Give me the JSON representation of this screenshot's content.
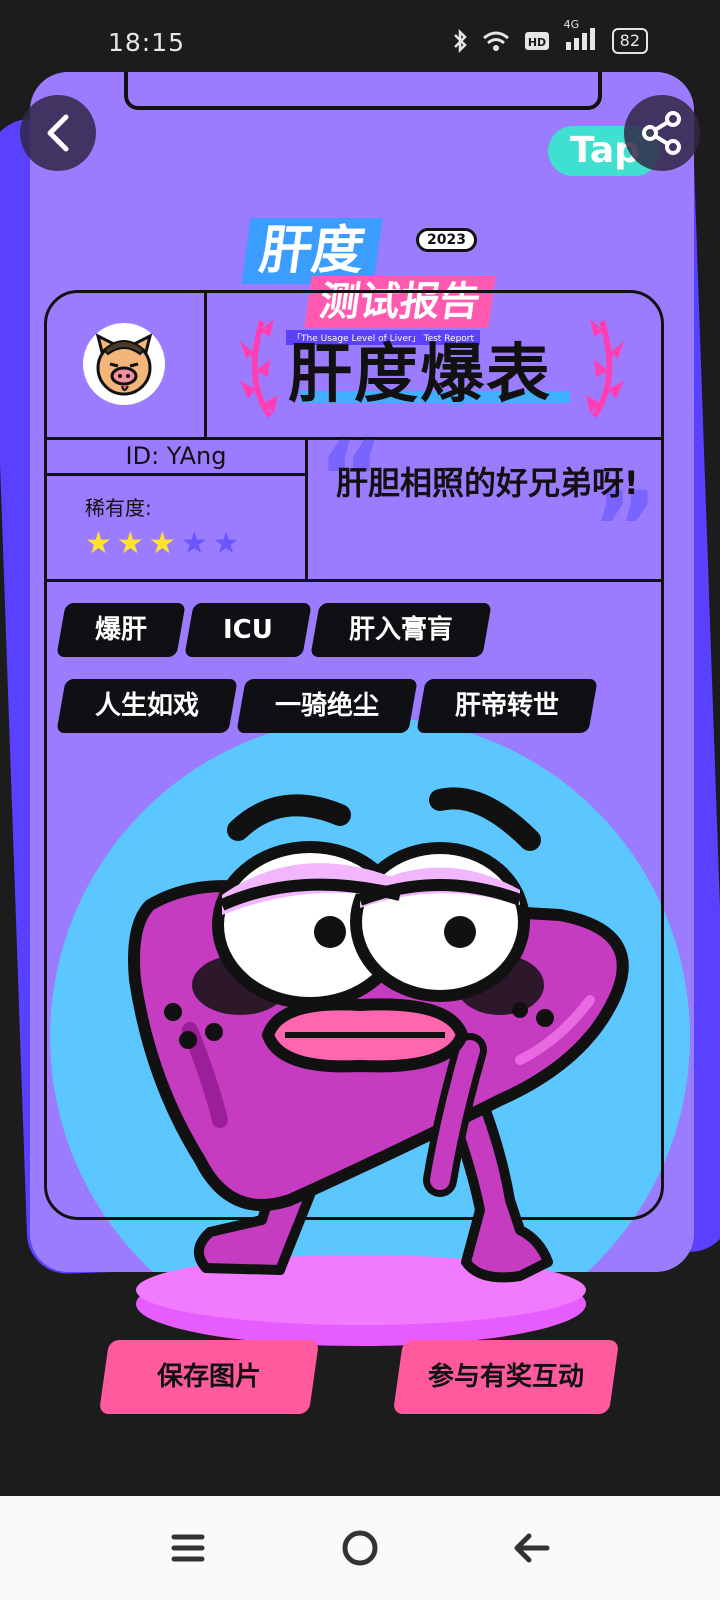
{
  "status_bar": {
    "time": "18:15",
    "network": "4G",
    "battery": "82"
  },
  "header": {
    "logo_title_line1": "肝度",
    "logo_year": "2023",
    "logo_title_line2": "测试报告",
    "logo_subtitle": "「The Usage Level of Liver」 Test Report",
    "brand_badge": "Tap"
  },
  "profile": {
    "rank_title": "肝度爆表",
    "user_id": "ID: YAng",
    "rarity_label": "稀有度:",
    "rarity_stars_filled": 3,
    "rarity_stars_total": 5,
    "quote": "肝胆相照的好兄弟呀!"
  },
  "tags": [
    [
      "爆肝",
      "ICU",
      "肝入膏肓"
    ],
    [
      "人生如戏",
      "一骑绝尘",
      "肝帝转世"
    ]
  ],
  "actions": {
    "save_label": "保存图片",
    "interact_label": "参与有奖互动"
  },
  "colors": {
    "card": "#9b7cff",
    "card_shadow": "#5a40ff",
    "circle": "#5cc6ff",
    "button": "#ff5a9e",
    "star_filled": "#ffe22e",
    "star_empty": "#6a55ff"
  },
  "icons": [
    "back-arrow-icon",
    "share-icon",
    "menu-icon",
    "home-icon",
    "back-nav-icon",
    "bluetooth-icon",
    "wifi-icon",
    "signal-icon",
    "battery-icon"
  ]
}
